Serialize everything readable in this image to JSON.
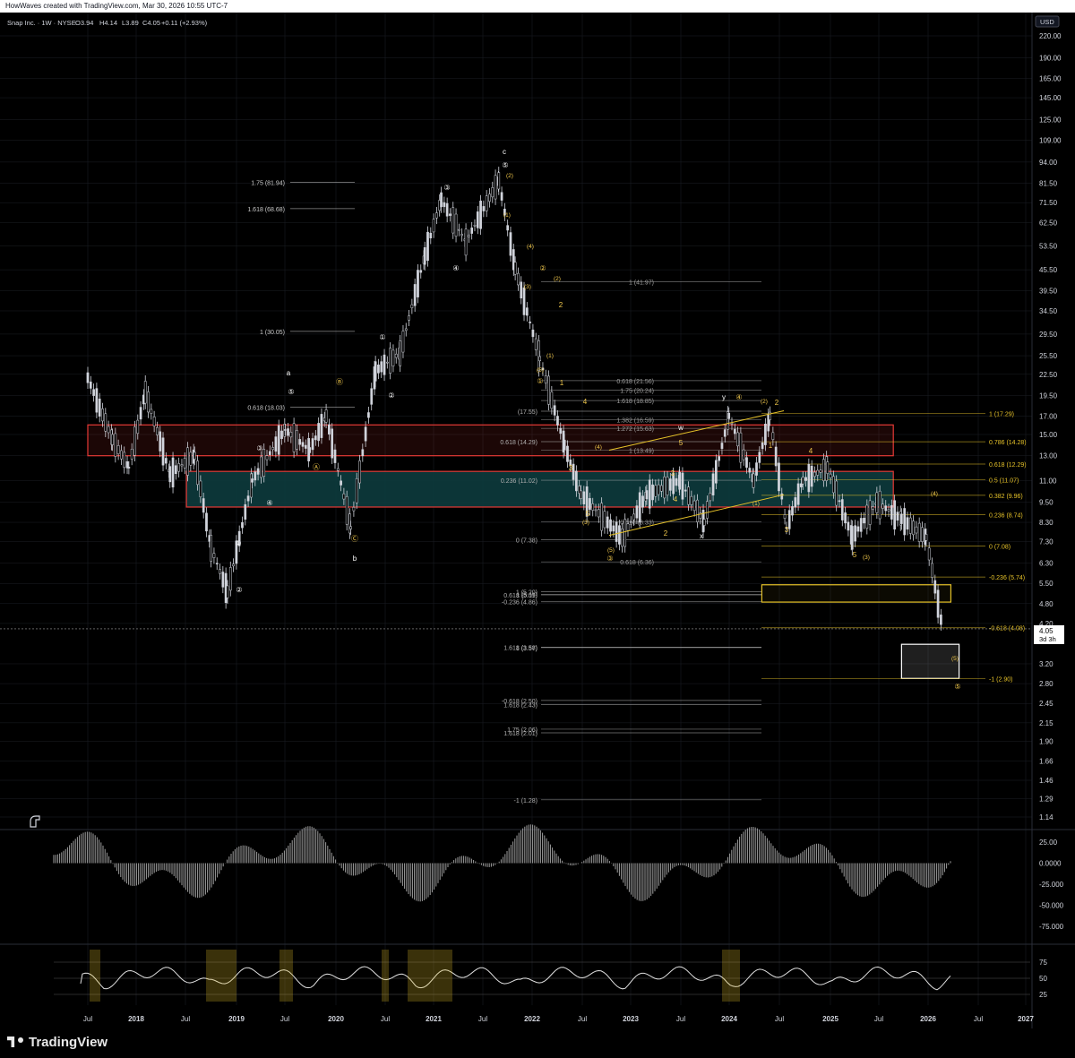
{
  "header": {
    "attribution": "HowWaves created with TradingView.com, Mar 30, 2026 10:55 UTC-7"
  },
  "symbol": {
    "title": "Snap Inc. · 1W · NYSE",
    "open": "O3.94",
    "high": "H4.14",
    "low": "L3.89",
    "close": "C4.05",
    "change": "+0.11 (+2.93%)",
    "change_color": "#26a69a"
  },
  "currency": "USD",
  "last_price": {
    "value": "4.05",
    "countdown": "3d 3h"
  },
  "footer": {
    "brand": "TradingView"
  },
  "colors": {
    "background": "#000000",
    "grid": "#1c1f26",
    "candle": "#d1d4dc",
    "fib_yellow": "#e6c229",
    "red_zone": "#e53935",
    "teal_zone": "#0d3b3d",
    "elliott_white": "#ffffff",
    "elliott_yellow": "#f2c94c"
  },
  "chart_data": {
    "type": "candlestick",
    "scale": "log",
    "y_ticks": [
      "220.00",
      "190.00",
      "165.00",
      "145.00",
      "125.00",
      "109.00",
      "94.00",
      "81.50",
      "71.50",
      "62.50",
      "53.50",
      "45.50",
      "39.50",
      "34.50",
      "29.50",
      "25.50",
      "22.50",
      "19.50",
      "17.00",
      "15.00",
      "13.00",
      "11.00",
      "9.50",
      "8.30",
      "7.30",
      "6.30",
      "5.50",
      "4.80",
      "4.20",
      "3.20",
      "2.80",
      "2.45",
      "2.15",
      "1.90",
      "1.66",
      "1.46",
      "1.29",
      "1.14"
    ],
    "x_ticks": [
      "Jul",
      "2018",
      "Jul",
      "2019",
      "Jul",
      "2020",
      "Jul",
      "2021",
      "Jul",
      "2022",
      "Jul",
      "2023",
      "Jul",
      "2024",
      "Jul",
      "2025",
      "Jul",
      "2026",
      "Jul",
      "2027"
    ],
    "oscillator_1_ticks": [
      "25.00",
      "0.0000",
      "-25.000",
      "-50.000",
      "-75.000"
    ],
    "oscillator_2_ticks": [
      "75",
      "50",
      "25"
    ],
    "price_path": [
      [
        "2017-07",
        22
      ],
      [
        "2017-10",
        14.5
      ],
      [
        "2017-12",
        12
      ],
      [
        "2018-02",
        20
      ],
      [
        "2018-05",
        11.5
      ],
      [
        "2018-08",
        13
      ],
      [
        "2018-10",
        7
      ],
      [
        "2018-12",
        5.2
      ],
      [
        "2019-03",
        11
      ],
      [
        "2019-07",
        15.5
      ],
      [
        "2019-10",
        13.5
      ],
      [
        "2019-12",
        17
      ],
      [
        "2020-03",
        8
      ],
      [
        "2020-06",
        23
      ],
      [
        "2020-09",
        26
      ],
      [
        "2020-12",
        50
      ],
      [
        "2021-02",
        73
      ],
      [
        "2021-05",
        55
      ],
      [
        "2021-09",
        83
      ],
      [
        "2021-11",
        46
      ],
      [
        "2022-02",
        25
      ],
      [
        "2022-05",
        14
      ],
      [
        "2022-07",
        10
      ],
      [
        "2022-12",
        7.5
      ],
      [
        "2023-03",
        10
      ],
      [
        "2023-07",
        11
      ],
      [
        "2023-10",
        8.3
      ],
      [
        "2024-01",
        17
      ],
      [
        "2024-04",
        11
      ],
      [
        "2024-06",
        17
      ],
      [
        "2024-08",
        8
      ],
      [
        "2024-10",
        11
      ],
      [
        "2025-01",
        12
      ],
      [
        "2025-04",
        7.5
      ],
      [
        "2025-07",
        9.5
      ],
      [
        "2025-10",
        8.5
      ],
      [
        "2026-01",
        7.5
      ],
      [
        "2026-03",
        4.05
      ]
    ],
    "zones": [
      {
        "label": "",
        "from_date": "2017-07",
        "to_date": "2025-09",
        "low": 13.0,
        "high": 16.0,
        "color": "red"
      },
      {
        "label": "",
        "from_date": "2018-07",
        "to_date": "2025-09",
        "low": 9.2,
        "high": 11.7,
        "color": "teal"
      },
      {
        "label": "",
        "from_date": "2024-05",
        "to_date": "2026-04",
        "low": 4.85,
        "high": 5.45,
        "color": "yellow"
      },
      {
        "label": "",
        "from_date": "2025-10",
        "to_date": "2026-05",
        "low": 2.9,
        "high": 3.65,
        "color": "white"
      }
    ],
    "fib_levels_left": [
      {
        "label": "1.75 (81.94)",
        "value": 81.94
      },
      {
        "label": "1.618 (68.68)",
        "value": 68.68
      },
      {
        "label": "1 (30.05)",
        "value": 30.05
      },
      {
        "label": "0.618 (18.03)",
        "value": 18.03
      }
    ],
    "fib_levels_mid": [
      {
        "label": "1 (41.97)",
        "value": 41.97
      },
      {
        "label": "0.618 (21.56)",
        "value": 21.56
      },
      {
        "label": "1.75 (20.24)",
        "value": 20.24
      },
      {
        "label": "1.618 (18.85)",
        "value": 18.85
      },
      {
        "label": "1.382 (16.59)",
        "value": 16.59
      },
      {
        "label": "1.272 (15.63)",
        "value": 15.63
      },
      {
        "label": "1 (13.49)",
        "value": 13.49
      },
      {
        "label": "0.618 (8.33)",
        "value": 8.33
      },
      {
        "label": "0.618 (6.36)",
        "value": 6.36
      },
      {
        "label": "1 (5.20)",
        "value": 5.2
      },
      {
        "label": "1.618 (3.58)",
        "value": 3.58
      },
      {
        "label": "1.618 (2.43)",
        "value": 2.43
      },
      {
        "label": "1.75 (2.06)",
        "value": 2.06
      },
      {
        "label": "-0.618 (2.50)",
        "value": 2.5
      },
      {
        "label": "-1 (1.28)",
        "value": 1.28
      },
      {
        "label": "1 (3.57)",
        "value": 3.57
      },
      {
        "label": "1.618 (2.01)",
        "value": 2.01
      },
      {
        "label": "-0.236 (4.86)",
        "value": 4.86
      },
      {
        "label": "0.618 (5.09)",
        "value": 5.09
      },
      {
        "label": "1 (5.11)",
        "value": 5.11
      },
      {
        "label": "0 (7.38)",
        "value": 7.38
      },
      {
        "label": "(17.55)",
        "value": 17.55
      },
      {
        "label": "0.618 (14.29)",
        "value": 14.29
      },
      {
        "label": "0.236 (11.02)",
        "value": 11.02
      }
    ],
    "fib_levels_right": [
      {
        "label": "1 (17.29)",
        "value": 17.29
      },
      {
        "label": "0.786 (14.28)",
        "value": 14.28
      },
      {
        "label": "0.618 (12.29)",
        "value": 12.29
      },
      {
        "label": "0.5 (11.07)",
        "value": 11.07
      },
      {
        "label": "0.382 (9.96)",
        "value": 9.96
      },
      {
        "label": "0.236 (8.74)",
        "value": 8.74
      },
      {
        "label": "0 (7.08)",
        "value": 7.08
      },
      {
        "label": "-0.236 (5.74)",
        "value": 5.74
      },
      {
        "label": "-0.618 (4.08)",
        "value": 4.08
      },
      {
        "label": "-1 (2.90)",
        "value": 2.9
      }
    ],
    "wave_labels": [
      "a",
      "b",
      "c",
      "w",
      "x",
      "y",
      "①",
      "②",
      "③",
      "④",
      "⑤",
      "Ⓐ",
      "Ⓑ",
      "Ⓒ",
      "Ⓢ",
      "(1)",
      "(2)",
      "(3)",
      "(4)",
      "(5)",
      "1",
      "2",
      "3",
      "4",
      "5"
    ]
  }
}
